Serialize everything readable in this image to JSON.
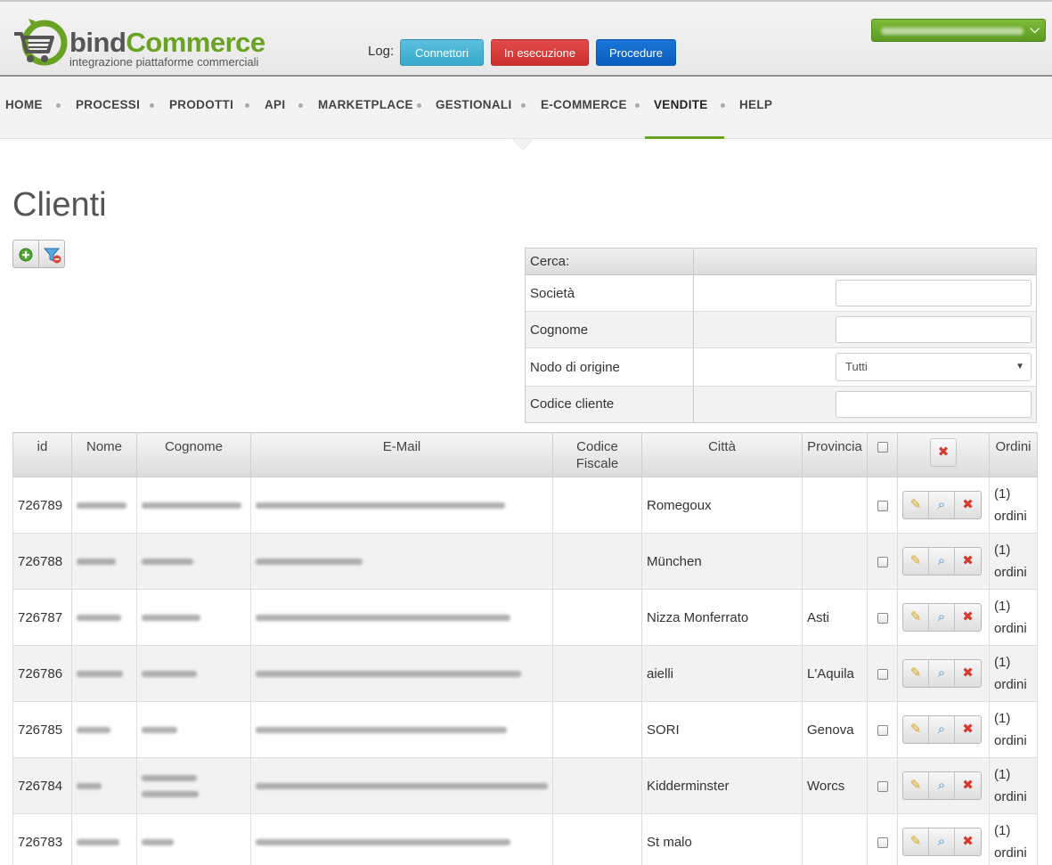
{
  "header": {
    "brand_bind": "bind",
    "brand_commerce": "Commerce",
    "brand_tagline": "integrazione piattaforme commerciali",
    "log_label": "Log:",
    "buttons": {
      "connettori": "Connettori",
      "in_esecuzione": "In esecuzione",
      "procedure": "Procedure"
    },
    "user_menu_chevron": "chevron-down-icon"
  },
  "nav": {
    "items": [
      "HOME",
      "PROCESSI",
      "PRODOTTI",
      "API",
      "MARKETPLACE",
      "GESTIONALI",
      "E-COMMERCE",
      "VENDITE",
      "HELP"
    ],
    "active": "VENDITE"
  },
  "page": {
    "title": "Clienti"
  },
  "search": {
    "header": "Cerca:",
    "fields": {
      "societa": {
        "label": "Società",
        "value": ""
      },
      "cognome": {
        "label": "Cognome",
        "value": ""
      },
      "nodo": {
        "label": "Nodo di origine",
        "selected": "Tutti"
      },
      "codice": {
        "label": "Codice cliente",
        "value": ""
      }
    }
  },
  "table": {
    "columns": {
      "id": "id",
      "nome": "Nome",
      "cognome": "Cognome",
      "email": "E-Mail",
      "cf1": "Codice",
      "cf2": "Fiscale",
      "citta": "Città",
      "provincia": "Provincia",
      "ordini": "Ordini"
    },
    "rows": [
      {
        "id": "726789",
        "citta": "Romegoux",
        "provincia": "",
        "ordini_count": "(1)",
        "ordini_label": "ordini"
      },
      {
        "id": "726788",
        "citta": "München",
        "provincia": "",
        "ordini_count": "(1)",
        "ordini_label": "ordini"
      },
      {
        "id": "726787",
        "citta": "Nizza Monferrato",
        "provincia": "Asti",
        "ordini_count": "(1)",
        "ordini_label": "ordini"
      },
      {
        "id": "726786",
        "citta": "aielli",
        "provincia": "L'Aquila",
        "ordini_count": "(1)",
        "ordini_label": "ordini"
      },
      {
        "id": "726785",
        "citta": "SORI",
        "provincia": "Genova",
        "ordini_count": "(1)",
        "ordini_label": "ordini"
      },
      {
        "id": "726784",
        "citta": "Kidderminster",
        "provincia": "Worcs",
        "ordini_count": "(1)",
        "ordini_label": "ordini"
      },
      {
        "id": "726783",
        "citta": "St malo",
        "provincia": "",
        "ordini_count": "(1)",
        "ordini_label": "ordini"
      }
    ]
  },
  "colors": {
    "brand_green": "#6aa324",
    "info": "#5bc0de",
    "danger": "#d9382e",
    "primary": "#0b5cbf"
  }
}
